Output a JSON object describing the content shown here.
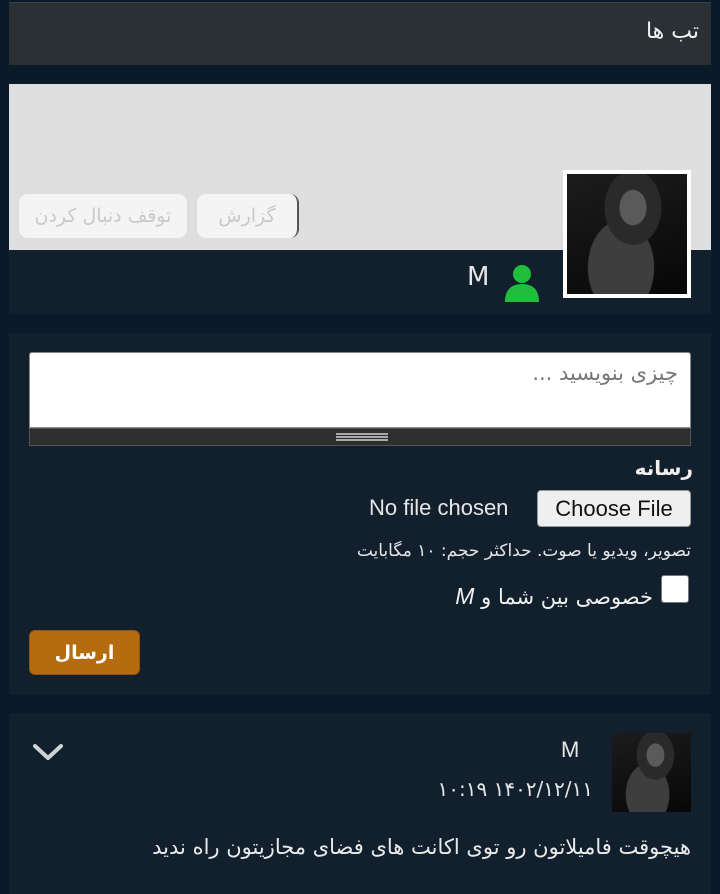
{
  "tabs": {
    "title": "تب ها"
  },
  "profile": {
    "name": "M",
    "report_label": "گزارش",
    "unfollow_label": "توقف دنبال کردن",
    "online_color": "#1fbf3c"
  },
  "compose": {
    "placeholder": "چیزی بنویسید ...",
    "media_label": "رسانه",
    "file_button": "Choose File",
    "file_status": "No file chosen",
    "media_hint": "تصویر، ویدیو یا صوت. حداکثر حجم: ۱۰ مگابایت",
    "private_label_prefix": "خصوصی بین شما و",
    "private_label_user": "M",
    "send_label": "ارسال",
    "accent_color": "#b46c0f"
  },
  "post": {
    "author": "M",
    "date": "۱۴۰۲/۱۲/۱۱ ۱۰:۱۹",
    "text": "هیچوقت فامیلاتون رو توی اکانت های فضای مجازیتون راه ندید"
  }
}
